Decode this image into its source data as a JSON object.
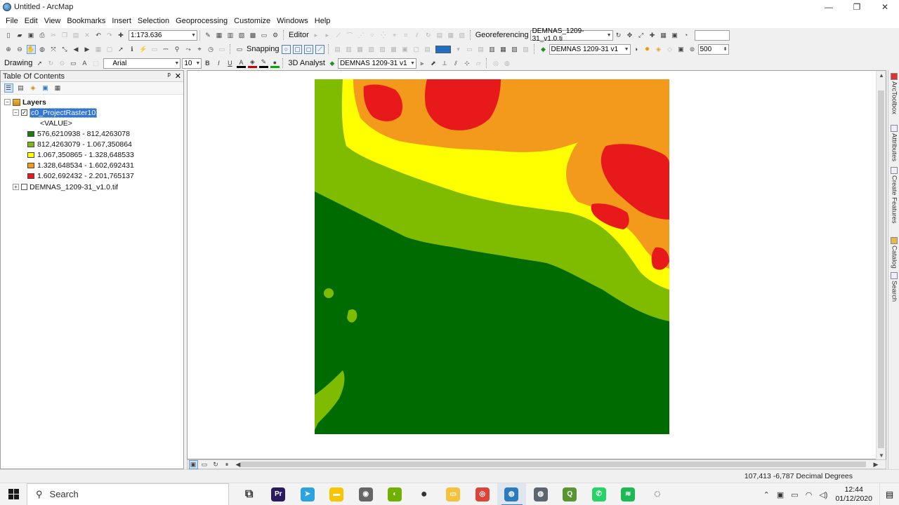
{
  "window": {
    "title": "Untitled - ArcMap",
    "minimize": "—",
    "maximize": "❐",
    "close": "✕"
  },
  "menu": [
    "File",
    "Edit",
    "View",
    "Bookmarks",
    "Insert",
    "Selection",
    "Geoprocessing",
    "Customize",
    "Windows",
    "Help"
  ],
  "toolbar1": {
    "scale": "1:173.636",
    "editor": "Editor",
    "georeferencing": "Georeferencing",
    "geo_layer": "DEMNAS_1209-31_v1.0.ti"
  },
  "toolbar2": {
    "snapping": "Snapping",
    "layer_select": "DEMNAS 1209-31 v1",
    "value": "500"
  },
  "toolbar3": {
    "drawing": "Drawing",
    "font": "Arial",
    "font_size": "10",
    "bold": "B",
    "italic": "I",
    "underline": "U",
    "analyst": "3D Analyst",
    "analyst_layer": "DEMNAS 1209-31 v1"
  },
  "toc": {
    "title": "Table Of Contents",
    "pin": "ᵖ",
    "close": "✕",
    "root": "Layers",
    "layer1": {
      "name": "c0_ProjectRaster10",
      "field": "<VALUE>",
      "classes": [
        {
          "label": "576,6210938 - 812,4263078",
          "color": "#1f7a0f"
        },
        {
          "label": "812,4263079 - 1.067,350864",
          "color": "#7fb51a"
        },
        {
          "label": "1.067,350865 - 1.328,648533",
          "color": "#ffff00"
        },
        {
          "label": "1.328,648534 - 1.602,692431",
          "color": "#f39a1c"
        },
        {
          "label": "1.602,692432 - 2.201,765137",
          "color": "#e8191a"
        }
      ]
    },
    "layer2": {
      "name": "DEMNAS_1209-31_v1.0.tif"
    }
  },
  "dock_tabs": [
    "ArcToolbox",
    "Attributes",
    "Create Features",
    "Catalog",
    "Search"
  ],
  "status": {
    "coords": "107,413  -6,787 Decimal Degrees"
  },
  "taskbar": {
    "search": "Search",
    "apps": [
      {
        "name": "task-view",
        "glyph": "⧉",
        "color": "#333333"
      },
      {
        "name": "premiere",
        "glyph": "Pr",
        "color": "#2a1a5e"
      },
      {
        "name": "telegram",
        "glyph": "➤",
        "color": "#2aa3df"
      },
      {
        "name": "sticky-notes",
        "glyph": "▬",
        "color": "#f7c600"
      },
      {
        "name": "disk-app",
        "glyph": "◉",
        "color": "#666666"
      },
      {
        "name": "nvidia",
        "glyph": "◐",
        "color": "#6fb000"
      },
      {
        "name": "obs",
        "glyph": "●",
        "color": "#333333"
      },
      {
        "name": "file-explorer",
        "glyph": "▭",
        "color": "#f4c23d"
      },
      {
        "name": "chrome",
        "glyph": "◎",
        "color": "#db4437"
      },
      {
        "name": "arcmap",
        "glyph": "◍",
        "color": "#2a7bbf"
      },
      {
        "name": "arccatalog",
        "glyph": "◍",
        "color": "#5d6670"
      },
      {
        "name": "qgis",
        "glyph": "Q",
        "color": "#589632"
      },
      {
        "name": "whatsapp",
        "glyph": "✆",
        "color": "#25d366"
      },
      {
        "name": "spotify",
        "glyph": "≋",
        "color": "#1db954"
      },
      {
        "name": "obs-studio",
        "glyph": "◌",
        "color": "#222222"
      }
    ],
    "time": "12:44",
    "date": "01/12/2020"
  }
}
